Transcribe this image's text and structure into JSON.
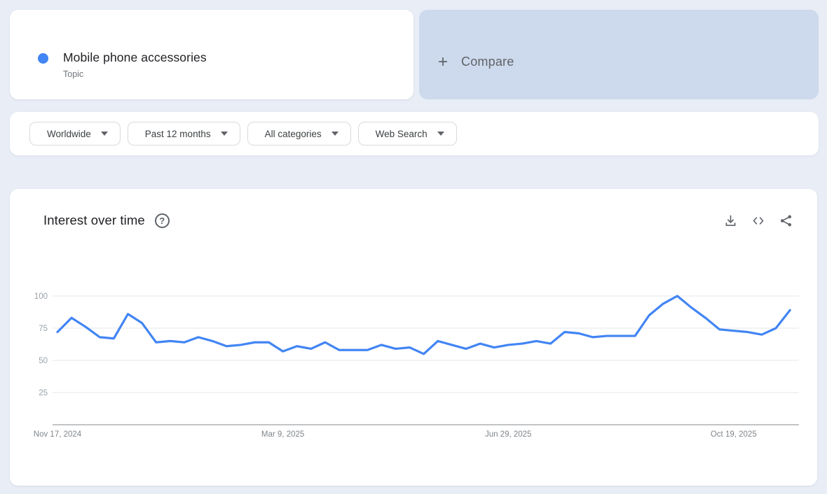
{
  "term_card": {
    "title": "Mobile phone accessories",
    "subtitle": "Topic",
    "dot_color": "#4285f4"
  },
  "compare_card": {
    "plus_glyph": "+",
    "label": "Compare"
  },
  "filters": [
    {
      "label": "Worldwide"
    },
    {
      "label": "Past 12 months"
    },
    {
      "label": "All categories"
    },
    {
      "label": "Web Search"
    }
  ],
  "chart_panel": {
    "title": "Interest over time",
    "help_glyph": "?",
    "icons": [
      "help-icon",
      "download-icon",
      "embed-icon",
      "share-icon"
    ]
  },
  "chart_data": {
    "type": "line",
    "title": "Interest over time",
    "x_unit": "week",
    "grid": true,
    "ylim": [
      0,
      100
    ],
    "y_ticks": [
      25,
      50,
      75,
      100
    ],
    "x_ticks": [
      {
        "index": 0,
        "label": "Nov 17, 2024"
      },
      {
        "index": 16,
        "label": "Mar 9, 2025"
      },
      {
        "index": 32,
        "label": "Jun 29, 2025"
      },
      {
        "index": 48,
        "label": "Oct 19, 2025"
      }
    ],
    "series": [
      {
        "name": "Mobile phone accessories",
        "color": "#4285f4",
        "values": [
          72,
          83,
          76,
          68,
          67,
          86,
          79,
          64,
          65,
          64,
          68,
          65,
          61,
          62,
          64,
          64,
          57,
          61,
          59,
          64,
          58,
          58,
          58,
          62,
          59,
          60,
          55,
          65,
          62,
          59,
          63,
          60,
          62,
          63,
          65,
          63,
          72,
          71,
          68,
          69,
          69,
          69,
          85,
          94,
          100,
          91,
          83,
          74,
          73,
          72,
          70,
          75,
          89
        ]
      }
    ],
    "colors": {
      "line": "#4285f4",
      "gridline": "#e4e7eb",
      "axis": "#83878c",
      "tick_label": "#9aa0a6"
    }
  }
}
